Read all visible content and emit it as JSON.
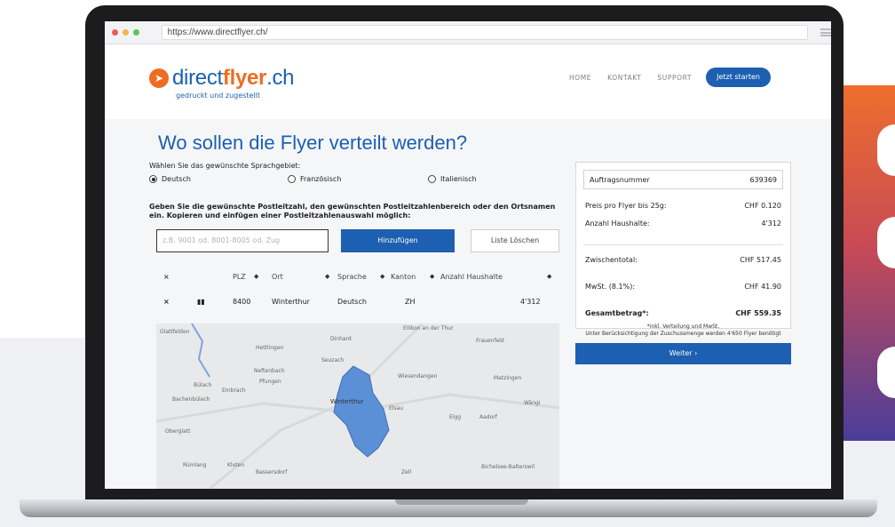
{
  "browser": {
    "url": "https://www.directflyer.ch/"
  },
  "site": {
    "logo_text_plain": "direct",
    "logo_text_bold": "flyer",
    "logo_text_suffix": ".ch",
    "tagline": "gedruckt und zugestellt",
    "nav": {
      "home": "HOME",
      "kontakt": "KONTAKT",
      "support": "SUPPORT",
      "cta": "Jetzt starten"
    }
  },
  "form": {
    "title": "Wo sollen die Flyer verteilt werden?",
    "language_label": "Wählen Sie das gewünschte Sprachgebiet:",
    "languages": [
      "Deutsch",
      "Französisch",
      "Italienisch"
    ],
    "selected_language": "Deutsch",
    "instructions": "Geben Sie die gewünschte Postleitzahl, den gewünschten Postleitzahlenbereich oder den Ortsnamen ein. Kopieren und einfügen einer Postleitzahlenauswahl möglich:",
    "input_placeholder": "z.B. 9001 od. 8001-8005 od. Zug",
    "add_button": "Hinzufügen",
    "clear_button": "Liste Löschen"
  },
  "table": {
    "headers": {
      "remove": "×",
      "plz": "PLZ",
      "ort": "Ort",
      "sprache": "Sprache",
      "kanton": "Kanton",
      "haushalte": "Anzahl Haushalte"
    },
    "rows": [
      {
        "remove": "×",
        "plz": "8400",
        "ort": "Winterthur",
        "sprache": "Deutsch",
        "kanton": "ZH",
        "haushalte": "4'312"
      }
    ]
  },
  "map": {
    "labels": [
      "Glattfelden",
      "Hettlingen",
      "Dinhard",
      "Ellikon an der Thur",
      "Frauenfeld",
      "Seuzach",
      "Neftenbach",
      "Pfungen",
      "Wiesendangen",
      "Matzingen",
      "Bülach",
      "Embrach",
      "Bachenbülach",
      "Winterthur",
      "Elsau",
      "Elgg",
      "Aadorf",
      "Wängi",
      "Oberglatt",
      "Kloten",
      "Rümlang",
      "Bassersdorf",
      "Zell",
      "Bichelsee-Balterswil"
    ]
  },
  "summary": {
    "order_label": "Auftragsnummer",
    "order_number": "639369",
    "price_label": "Preis pro Flyer bis 25g:",
    "price_value": "CHF 0.120",
    "households_label": "Anzahl Haushalte:",
    "households_value": "4'312",
    "subtotal_label": "Zwischentotal:",
    "subtotal_value": "CHF 517.45",
    "vat_label": "MwSt. (8.1%):",
    "vat_value": "CHF 41.90",
    "total_label": "Gesamtbetrag*:",
    "total_value": "CHF 559.35",
    "note_1": "*inkl. Verteilung und MwSt.",
    "note_2": "Unter Berücksichtigung der Zuschussmenge werden 4'650 Flyer benötigt",
    "next_button": "Weiter ›"
  },
  "colors": {
    "brand_blue": "#1d5fb0",
    "brand_orange": "#ef6c23",
    "map_region": "#5b8fd6"
  }
}
